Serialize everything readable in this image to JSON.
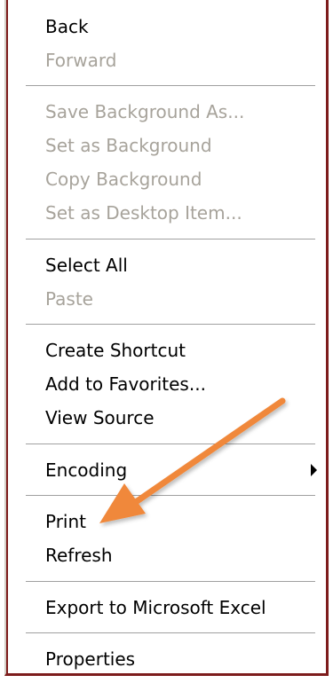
{
  "menu": {
    "items": [
      {
        "label": "Back",
        "enabled": true
      },
      {
        "label": "Forward",
        "enabled": false
      },
      {
        "label": "Save Background As...",
        "enabled": false
      },
      {
        "label": "Set as Background",
        "enabled": false
      },
      {
        "label": "Copy Background",
        "enabled": false
      },
      {
        "label": "Set as Desktop Item...",
        "enabled": false
      },
      {
        "label": "Select All",
        "enabled": true
      },
      {
        "label": "Paste",
        "enabled": false
      },
      {
        "label": "Create Shortcut",
        "enabled": true
      },
      {
        "label": "Add to Favorites...",
        "enabled": true
      },
      {
        "label": "View Source",
        "enabled": true
      },
      {
        "label": "Encoding",
        "enabled": true
      },
      {
        "label": "Print",
        "enabled": true
      },
      {
        "label": "Refresh",
        "enabled": true
      },
      {
        "label": "Export to Microsoft Excel",
        "enabled": true
      },
      {
        "label": "Properties",
        "enabled": true
      }
    ]
  },
  "colors": {
    "disabled_text": "#a7a39b",
    "frame": "#7d1c1c",
    "annotation_arrow": "#f0883a"
  },
  "icons": {
    "submenu": "chevron-right-icon",
    "annotation": "pointer-arrow-icon"
  }
}
